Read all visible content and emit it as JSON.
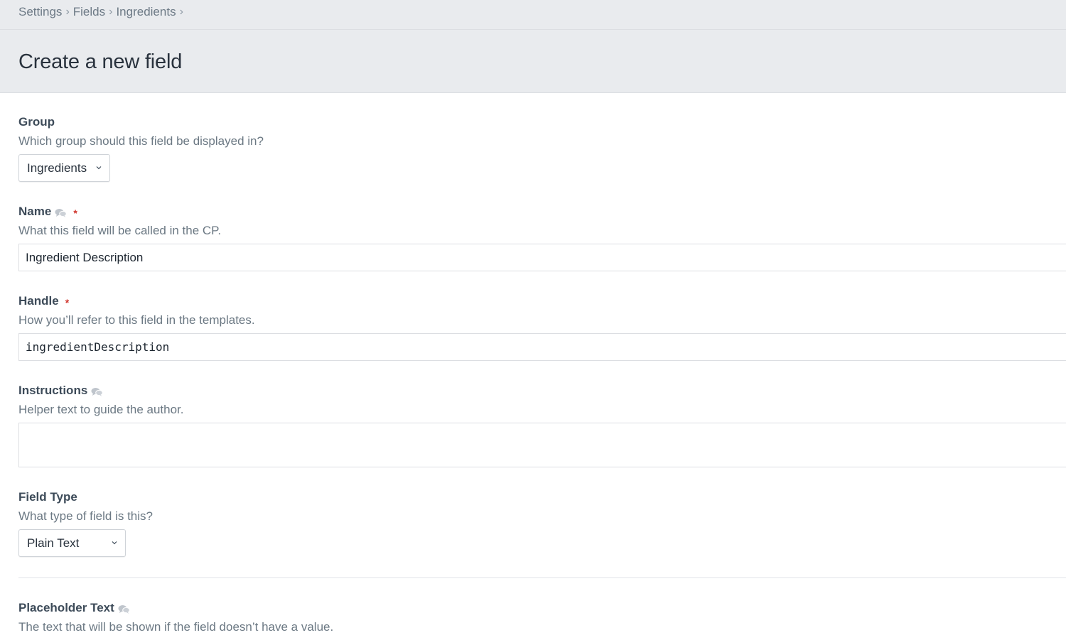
{
  "breadcrumb": {
    "items": [
      "Settings",
      "Fields",
      "Ingredients"
    ],
    "separator": "›"
  },
  "page": {
    "title": "Create a new field"
  },
  "fields": {
    "group": {
      "label": "Group",
      "instructions": "Which group should this field be displayed in?",
      "selected": "Ingredients"
    },
    "name": {
      "label": "Name",
      "instructions": "What this field will be called in the CP.",
      "value": "Ingredient Description",
      "required_mark": "*"
    },
    "handle": {
      "label": "Handle",
      "instructions": "How you’ll refer to this field in the templates.",
      "value": "ingredientDescription",
      "required_mark": "*"
    },
    "instructions": {
      "label": "Instructions",
      "instructions": "Helper text to guide the author.",
      "value": ""
    },
    "field_type": {
      "label": "Field Type",
      "instructions": "What type of field is this?",
      "selected": "Plain Text"
    },
    "placeholder_text": {
      "label": "Placeholder Text",
      "instructions": "The text that will be shown if the field doesn’t have a value."
    }
  },
  "colors": {
    "header_bg": "#e9ebee",
    "required": "#d0342c",
    "label": "#3d4b59",
    "instructions": "#6b7883",
    "border": "#dcdee2"
  },
  "icons": {
    "translatable": "comment-icon",
    "dropdown": "chevron-down-icon"
  }
}
